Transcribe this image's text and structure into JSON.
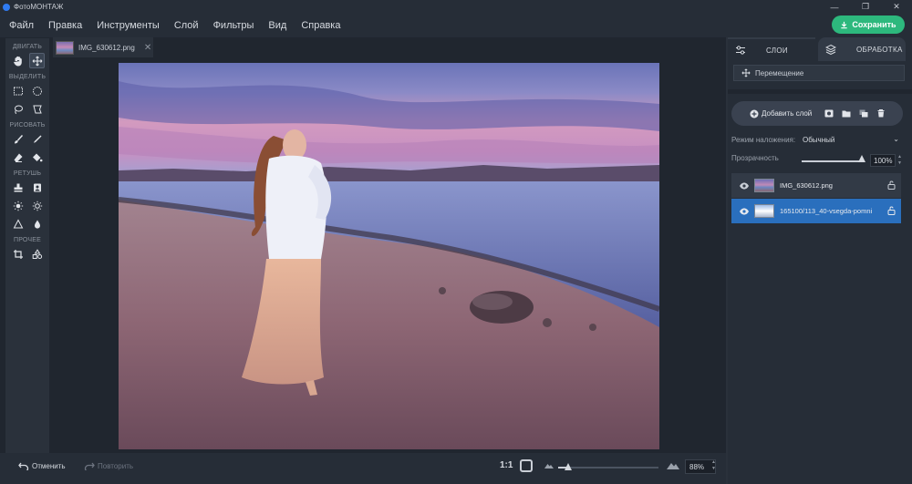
{
  "app": {
    "title": "ФотоМОНТАЖ"
  },
  "window_controls": [
    "—",
    "❐",
    "✕"
  ],
  "menu": {
    "items": [
      "Файл",
      "Правка",
      "Инструменты",
      "Слой",
      "Фильтры",
      "Вид",
      "Справка"
    ],
    "save_label": "Сохранить"
  },
  "tools": {
    "move_label": "ДВИГАТЬ",
    "select_label": "ВЫДЕЛИТЬ",
    "draw_label": "РИСОВАТЬ",
    "retouch_label": "РЕТУШЬ",
    "other_label": "ПРОЧЕЕ"
  },
  "document_tab": {
    "name": "IMG_630612.png",
    "close": "✕"
  },
  "bottom": {
    "undo_label": "Отменить",
    "redo_label": "Повторить",
    "one_to_one": "1:1",
    "zoom_value": "88%",
    "zoom_level": 0.1
  },
  "right_panel": {
    "tab_layers": "СЛОИ",
    "tab_processing": "ОБРАБОТКА",
    "move_mode": "Перемещение",
    "add_layer_label": "Добавить слой",
    "blend_label": "Режим наложения:",
    "blend_value": "Обычный",
    "opacity_label": "Прозрачность",
    "opacity_value": "100%",
    "layers": [
      {
        "name": "IMG_630612.png",
        "selected": false
      },
      {
        "name": "165100/113_40-vsegda-pomni",
        "selected": true
      }
    ]
  },
  "colors": {
    "accent_green": "#2db87d",
    "selected_blue": "#2a6fbd",
    "panel_bg": "#262d37",
    "canvas_bg": "#20262f"
  }
}
